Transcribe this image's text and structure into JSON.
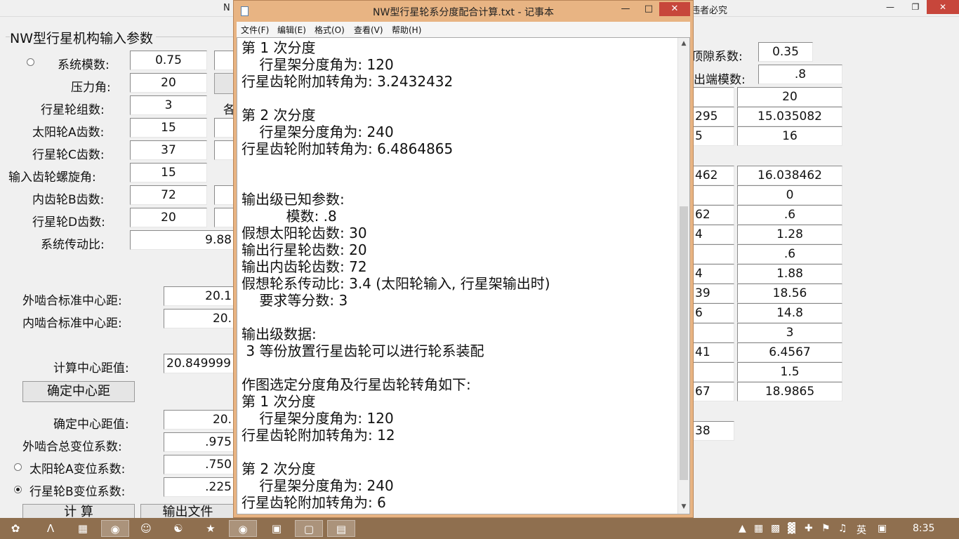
{
  "background_app": {
    "title_left": "N",
    "title_right": "违者必究",
    "group_title": "NW型行星机构输入参数",
    "inputs": [
      {
        "label": "系统模数:",
        "value": "0.75"
      },
      {
        "label": "压力角:",
        "value": "20"
      },
      {
        "label": "行星轮组数:",
        "value": "3"
      },
      {
        "label": "太阳轮A齿数:",
        "value": "15"
      },
      {
        "label": "行星轮C齿数:",
        "value": "37"
      },
      {
        "label": "输入齿轮螺旋角:",
        "value": "15"
      },
      {
        "label": "内齿轮B齿数:",
        "value": "72"
      },
      {
        "label": "行星轮D齿数:",
        "value": "20"
      },
      {
        "label": "系统传动比:",
        "value": "9.88"
      }
    ],
    "partial_label_char": "各",
    "center_distance": [
      {
        "label": "外啮合标准中心距:",
        "value": "20.1"
      },
      {
        "label": "内啮合标准中心距:",
        "value": "20."
      }
    ],
    "calc_label": "计算中心距值:",
    "calc_value": "20.849999",
    "confirm_button": "确定中心距",
    "results": [
      {
        "label": "确定中心距值:",
        "value": "20."
      },
      {
        "label": "外啮合总变位系数:",
        "value": ".975"
      },
      {
        "label": "太阳轮A变位系数:",
        "value": ".750"
      },
      {
        "label": "行星轮B变位系数:",
        "value": ".225"
      }
    ],
    "calc_button": "计  算",
    "output_button": "输出文件"
  },
  "right_panel": {
    "clearance_label": "顶隙系数:",
    "clearance_value": "0.35",
    "out_module_label": "出端模数:",
    "out_module_value": ".8",
    "rows": [
      {
        "left": "",
        "right": "20"
      },
      {
        "left": "295",
        "right": "15.035082"
      },
      {
        "left": "5",
        "right": "16"
      },
      {
        "left": "462",
        "right": "16.038462"
      },
      {
        "left": "",
        "right": "0"
      },
      {
        "left": "62",
        "right": ".6"
      },
      {
        "left": "4",
        "right": "1.28"
      },
      {
        "left": "",
        "right": ".6"
      },
      {
        "left": "4",
        "right": "1.88"
      },
      {
        "left": "39",
        "right": "18.56"
      },
      {
        "left": "6",
        "right": "14.8"
      },
      {
        "left": "",
        "right": "3"
      },
      {
        "left": "41",
        "right": "6.4567"
      },
      {
        "left": "",
        "right": "1.5"
      },
      {
        "left": "67",
        "right": "18.9865"
      }
    ],
    "bottom_value": "38"
  },
  "notepad": {
    "title": "NW型行星轮系分度配合计算.txt - 记事本",
    "menu": [
      "文件(F)",
      "编辑(E)",
      "格式(O)",
      "查看(V)",
      "帮助(H)"
    ],
    "lines": [
      "第 1 次分度",
      "    行星架分度角为: 120",
      "行星齿轮附加转角为: 3.2432432",
      "",
      "第 2 次分度",
      "    行星架分度角为: 240",
      "行星齿轮附加转角为: 6.4864865",
      "",
      "",
      "输出级已知参数:",
      "          模数: .8",
      "假想太阳轮齿数: 30",
      "输出行星轮齿数: 20",
      "输出内齿轮齿数: 72",
      "假想轮系传动比: 3.4 (太阳轮输入, 行星架输出时)",
      "    要求等分数: 3",
      "",
      "输出级数据:",
      " 3 等份放置行星齿轮可以进行轮系装配",
      "",
      "作图选定分度角及行星齿轮转角如下:",
      "第 1 次分度",
      "    行星架分度角为: 120",
      "行星齿轮附加转角为: 12",
      "",
      "第 2 次分度",
      "    行星架分度角为: 240",
      "行星齿轮附加转角为: 6"
    ]
  },
  "taskbar": {
    "ime": "英",
    "clock": "8:35"
  },
  "colors": {
    "taskbar": "#8f6f4f",
    "notepad_frame": "#e8b483",
    "close_button": "#c7463b",
    "window_bg": "#f0f0f0"
  }
}
